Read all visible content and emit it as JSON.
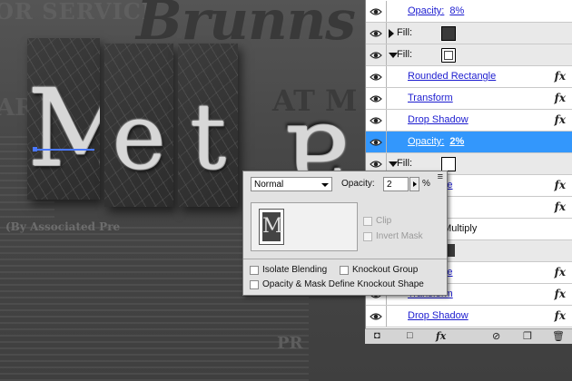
{
  "canvas": {
    "newspaper": {
      "service": "OR SERVICE",
      "masthead": "Brunns",
      "at_m": "AT M",
      "ar": "AR",
      "associated": "(By Associated Pre",
      "pr": "PR"
    },
    "letters": [
      "M",
      "e",
      "t",
      "a"
    ]
  },
  "layers": {
    "rows": [
      {
        "type": "effect",
        "label": "Opacity:",
        "value": "8%",
        "style": "white"
      },
      {
        "type": "fill",
        "label": "Fill:",
        "state": "collapsed",
        "swatch": "dark"
      },
      {
        "type": "fill",
        "label": "Fill:",
        "state": "expanded",
        "swatch": "outline"
      },
      {
        "type": "effect",
        "label": "Rounded Rectangle",
        "fx": "fx",
        "style": "white"
      },
      {
        "type": "effect",
        "label": "Transform",
        "fx": "fx",
        "style": "white"
      },
      {
        "type": "effect",
        "label": "Drop Shadow",
        "fx": "fx",
        "style": "white"
      },
      {
        "type": "effect",
        "label": "Opacity:",
        "value": "2%",
        "style": "selected"
      },
      {
        "type": "fill",
        "label": "Fill:",
        "state": "expanded",
        "swatch": "plain"
      },
      {
        "type": "effect",
        "label": "Rectangle",
        "fx": "fx",
        "style": "white"
      },
      {
        "type": "effect",
        "label": "n",
        "fx": "fx",
        "style": "white"
      },
      {
        "type": "effect",
        "label": "40% Multiply",
        "style": "plain"
      },
      {
        "type": "chip",
        "label": "",
        "style": "gray"
      },
      {
        "type": "effect",
        "label": "Rectangle",
        "fx": "fx",
        "style": "white"
      },
      {
        "type": "effect",
        "label": "Transform",
        "fx": "fx",
        "style": "white"
      },
      {
        "type": "effect",
        "label": "Drop Shadow",
        "fx": "fx",
        "style": "white"
      }
    ],
    "footer_icons": [
      "new-layer-icon",
      "square-icon",
      "fx-icon",
      "circle-slash-icon",
      "duplicate-icon",
      "trash-icon"
    ]
  },
  "popup": {
    "blend_mode": "Normal",
    "opacity_label": "Opacity:",
    "opacity_value": "2",
    "opacity_unit": "%",
    "clip_label": "Clip",
    "invert_mask_label": "Invert Mask",
    "isolate_label": "Isolate Blending",
    "knockout_group_label": "Knockout Group",
    "mask_define_label": "Opacity & Mask Define Knockout Shape",
    "thumb_letter": "M"
  }
}
